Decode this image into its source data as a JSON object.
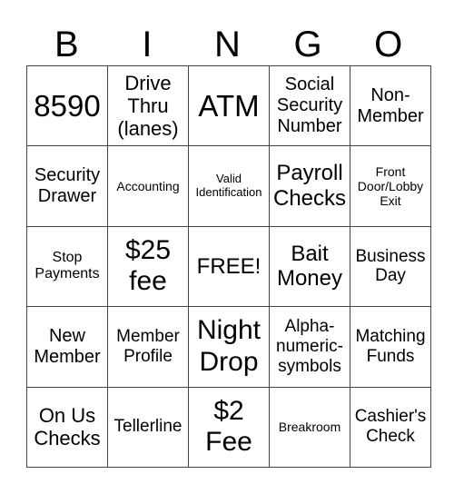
{
  "header": [
    "B",
    "I",
    "N",
    "G",
    "O"
  ],
  "rows": [
    [
      "8590",
      "Drive Thru (lanes)",
      "ATM",
      "Social Security Number",
      "Non-Member"
    ],
    [
      "Security Drawer",
      "Accounting",
      "Valid Identification",
      "Payroll Checks",
      "Front Door/Lobby Exit"
    ],
    [
      "Stop Payments",
      "$25 fee",
      "FREE!",
      "Bait Money",
      "Business Day"
    ],
    [
      "New Member",
      "Member Profile",
      "Night Drop",
      "Alpha-numeric-symbols",
      "Matching Funds"
    ],
    [
      "On Us Checks",
      "Tellerline",
      "$2 Fee",
      "Breakroom",
      "Cashier's Check"
    ]
  ]
}
